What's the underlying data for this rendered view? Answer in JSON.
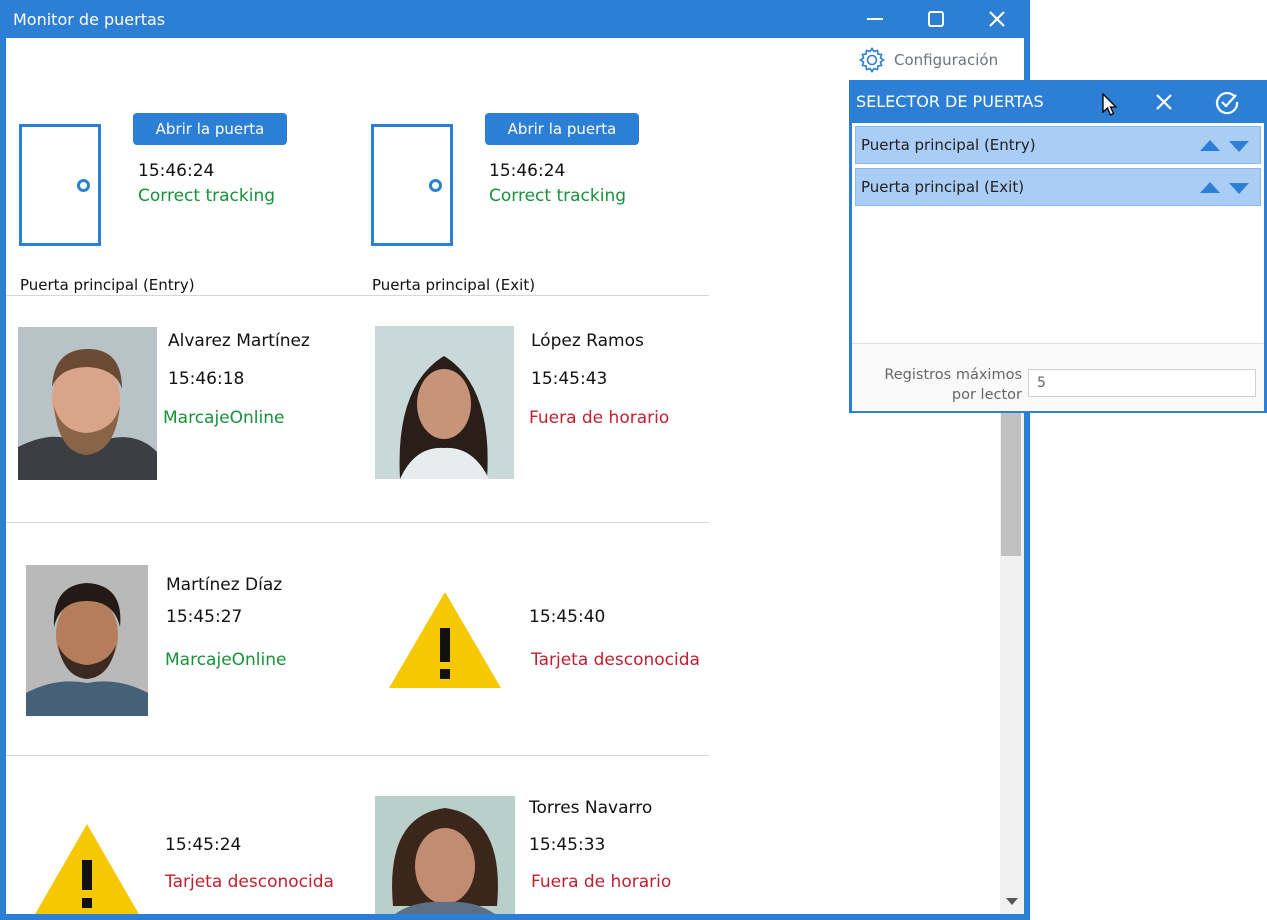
{
  "window": {
    "title": "Monitor de puertas",
    "accent_color": "#2d7fd6"
  },
  "toolbar": {
    "config_label": "Configuración",
    "config_icon": "gear-icon"
  },
  "doors": [
    {
      "label": "Puerta principal (Entry)",
      "button": "Abrir la puerta",
      "time": "15:46:24",
      "status": "Correct tracking"
    },
    {
      "label": "Puerta principal (Exit)",
      "button": "Abrir la puerta",
      "time": "15:46:24",
      "status": "Correct tracking"
    }
  ],
  "events": [
    {
      "name": "Alvarez Martínez",
      "time": "15:46:18",
      "status": "MarcajeOnline",
      "status_color": "#17923a",
      "kind": "photo"
    },
    {
      "name": "López Ramos",
      "time": "15:45:43",
      "status": "Fuera de horario",
      "status_color": "#c21f2e",
      "kind": "photo"
    },
    {
      "name": "Martínez Díaz",
      "time": "15:45:27",
      "status": "MarcajeOnline",
      "status_color": "#17923a",
      "kind": "photo"
    },
    {
      "name": "",
      "time": "15:45:40",
      "status": "Tarjeta desconocida",
      "status_color": "#c21f2e",
      "kind": "warning-icon"
    },
    {
      "name": "",
      "time": "15:45:24",
      "status": "Tarjeta desconocida",
      "status_color": "#c21f2e",
      "kind": "warning-icon"
    },
    {
      "name": "Torres Navarro",
      "time": "15:45:33",
      "status": "Fuera de horario",
      "status_color": "#c21f2e",
      "kind": "photo"
    }
  ],
  "selector": {
    "title": "SELECTOR DE PUERTAS",
    "items": [
      {
        "label": "Puerta principal (Entry)"
      },
      {
        "label": "Puerta principal (Exit)"
      }
    ],
    "max_label": "Registros máximos por lector",
    "max_value": "5"
  }
}
